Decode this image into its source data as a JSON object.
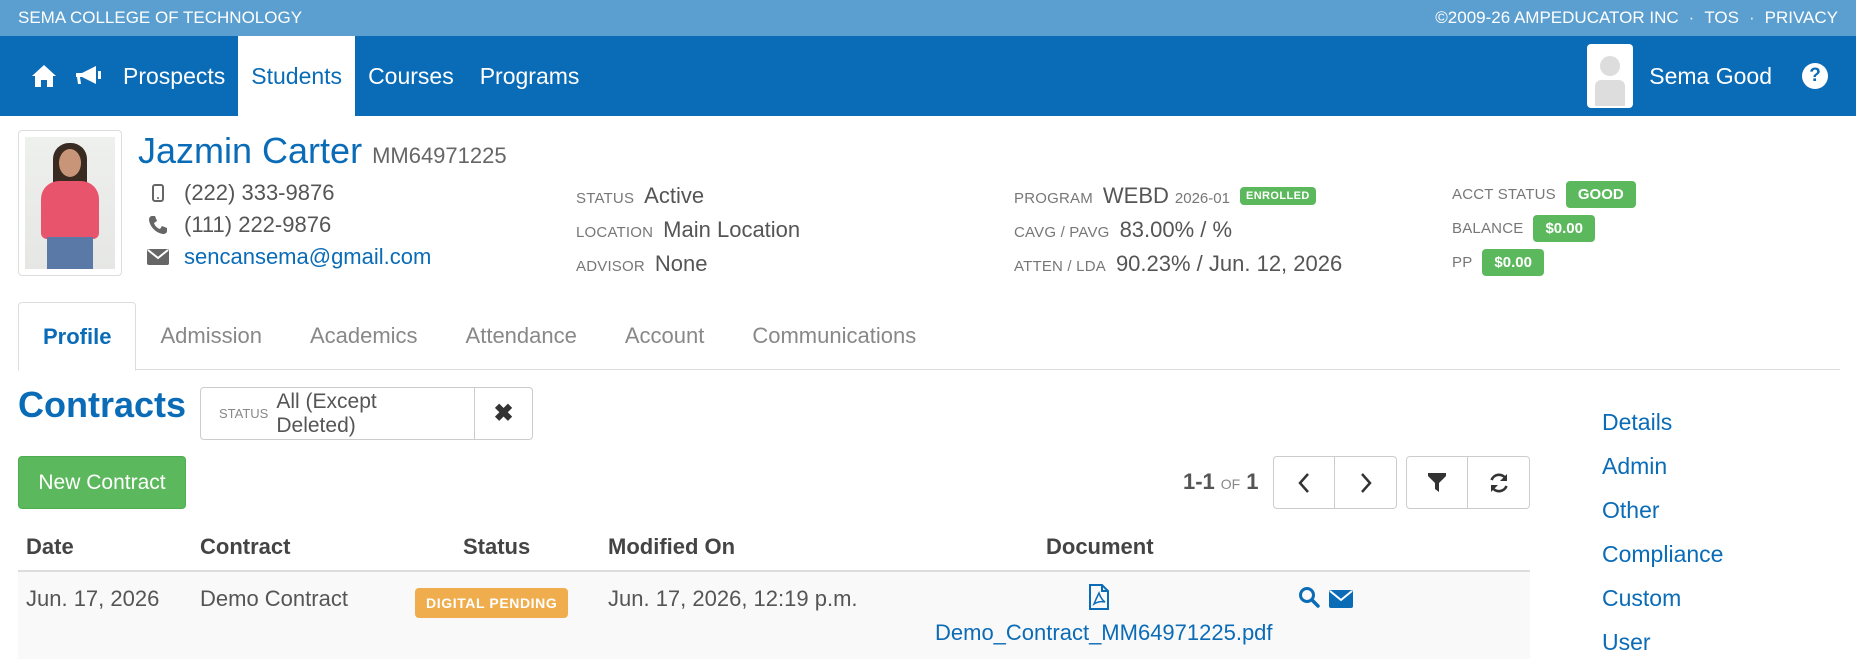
{
  "topbar": {
    "school": "SEMA COLLEGE OF TECHNOLOGY",
    "copyright": "©2009-26 AMPEDUCATOR INC",
    "tos": "TOS",
    "privacy": "PRIVACY",
    "separator": "·"
  },
  "nav": {
    "icons": [
      "home-icon",
      "bullhorn-icon"
    ],
    "items": [
      {
        "label": "Prospects",
        "active": false
      },
      {
        "label": "Students",
        "active": true
      },
      {
        "label": "Courses",
        "active": false
      },
      {
        "label": "Programs",
        "active": false
      }
    ],
    "user": "Sema Good",
    "help": "?"
  },
  "student": {
    "name": "Jazmin Carter",
    "id": "MM64971225",
    "mobile": "(222) 333-9876",
    "phone": "(111) 222-9876",
    "email": "sencansema@gmail.com"
  },
  "info": {
    "status_label": "STATUS",
    "status": "Active",
    "location_label": "LOCATION",
    "location": "Main Location",
    "advisor_label": "ADVISOR",
    "advisor": "None",
    "program_label": "PROGRAM",
    "program": "WEBD",
    "program_term": "2026-01",
    "program_badge": "ENROLLED",
    "cavg_label": "CAVG / PAVG",
    "cavg": "83.00% / %",
    "atten_label": "ATTEN / LDA",
    "atten": "90.23% / Jun. 12, 2026",
    "acct_label": "ACCT STATUS",
    "acct": "GOOD",
    "balance_label": "BALANCE",
    "balance": "$0.00",
    "pp_label": "PP",
    "pp": "$0.00"
  },
  "tabs": [
    {
      "label": "Profile",
      "active": true
    },
    {
      "label": "Admission",
      "active": false
    },
    {
      "label": "Academics",
      "active": false
    },
    {
      "label": "Attendance",
      "active": false
    },
    {
      "label": "Account",
      "active": false
    },
    {
      "label": "Communications",
      "active": false
    }
  ],
  "contracts": {
    "title": "Contracts",
    "status_filter_label": "STATUS",
    "status_filter_value": "All (Except Deleted)",
    "clear": "✖",
    "new_button": "New Contract",
    "pager_range": "1-1",
    "pager_of": "OF",
    "pager_total": "1",
    "columns": [
      "Date",
      "Contract",
      "Status",
      "Modified On",
      "Document"
    ],
    "rows": [
      {
        "date": "Jun. 17, 2026",
        "contract": "Demo Contract",
        "status": "DIGITAL PENDING",
        "modified": "Jun. 17, 2026, 12:19 p.m.",
        "document": "Demo_Contract_MM64971225.pdf"
      }
    ]
  },
  "side_nav": [
    "Details",
    "Admin",
    "Other",
    "Compliance",
    "Custom",
    "User"
  ],
  "colors": {
    "primary": "#0a6bb7",
    "topbar": "#5b9fd0",
    "success": "#5cb85c",
    "warning": "#f0ad4e"
  }
}
